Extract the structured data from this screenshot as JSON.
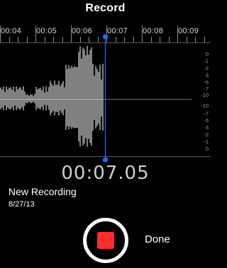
{
  "header": {
    "title": "Record"
  },
  "timeline": {
    "labels": [
      "00:04",
      "00:05",
      "00:06",
      "00:07",
      "00:08",
      "00:09"
    ],
    "playhead_time": "00:07"
  },
  "level_scale": {
    "upper": [
      "0",
      "-1",
      "-2",
      "-3",
      "-5",
      "-7",
      "-10"
    ],
    "lower": [
      "-10",
      "-7",
      "-5",
      "-3",
      "-2",
      "-1",
      "0"
    ]
  },
  "readout": {
    "elapsed": "00:07.05"
  },
  "recording": {
    "name": "New Recording",
    "date": "8/27/13"
  },
  "controls": {
    "done_label": "Done",
    "record_icon": "stop-square-icon"
  },
  "colors": {
    "playhead": "#1a6cff",
    "record": "#ff2d2d",
    "waveform": "#ffffff"
  }
}
